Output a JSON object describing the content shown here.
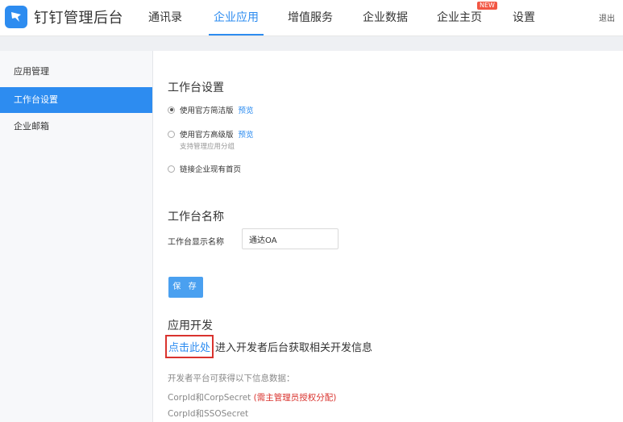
{
  "brand": "钉钉管理后台",
  "colors": {
    "accent": "#2d8cf0",
    "highlight_border": "#d9332e",
    "badge": "#f25643"
  },
  "nav": {
    "items": [
      {
        "label": "通讯录"
      },
      {
        "label": "企业应用"
      },
      {
        "label": "增值服务"
      },
      {
        "label": "企业数据"
      },
      {
        "label": "企业主页"
      },
      {
        "label": "设置"
      }
    ],
    "active_index": 1,
    "new_badge": "NEW",
    "logout": "退出"
  },
  "sidebar": {
    "items": [
      {
        "label": "应用管理"
      },
      {
        "label": "工作台设置"
      },
      {
        "label": "企业邮箱"
      }
    ],
    "active_index": 1
  },
  "workbench": {
    "title": "工作台设置",
    "options": [
      {
        "label": "使用官方简洁版",
        "link": "预览",
        "checked": true
      },
      {
        "label": "使用官方高级版",
        "link": "预览",
        "hint": "支持管理应用分组",
        "checked": false
      },
      {
        "label": "链接企业现有首页",
        "checked": false
      }
    ]
  },
  "workbench_name": {
    "title": "工作台名称",
    "field_label": "工作台显示名称",
    "value": "通达OA"
  },
  "save_label": "保 存",
  "dev": {
    "title": "应用开发",
    "click_here": "点击此处",
    "line_rest": "进入开发者后台获取相关开发信息",
    "info_title": "开发者平台可获得以下信息数据：",
    "item1_prefix": "CorpId和CorpSecret ",
    "item1_note": "(需主管理员授权分配)",
    "item2": "CorpId和SSOSecret"
  }
}
